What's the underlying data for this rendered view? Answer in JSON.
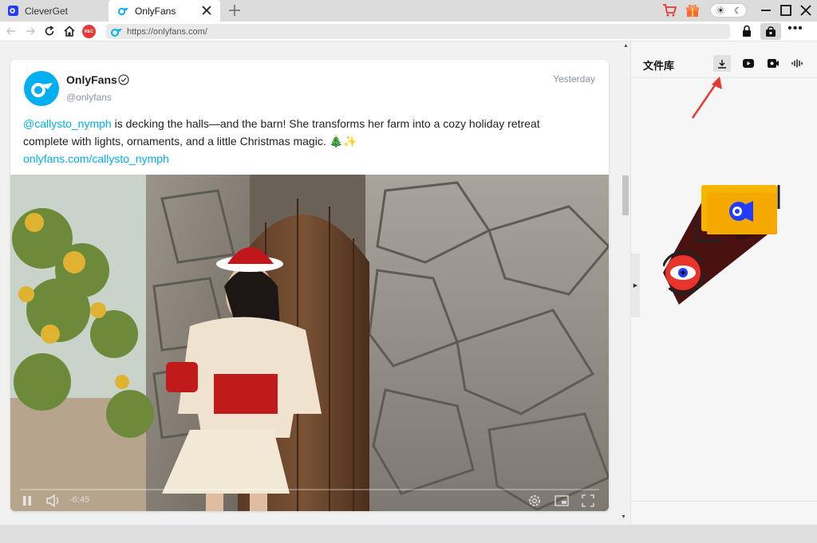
{
  "tabs": [
    {
      "label": "CleverGet",
      "active": false
    },
    {
      "label": "OnlyFans",
      "active": true
    }
  ],
  "toolbar": {
    "rec_label": "REC",
    "url": "https://onlyfans.com/"
  },
  "theme": {
    "sun": "☀",
    "moon": "☾"
  },
  "post": {
    "author": "OnlyFans",
    "handle": "@onlyfans",
    "time": "Yesterday",
    "mention": "@callysto_nymph",
    "body": " is decking the halls—and the barn! She transforms her farm into a cozy holiday retreat complete with lights, ornaments, and a little Christmas magic. 🎄✨",
    "link": "onlyfans.com/callysto_nymph"
  },
  "video": {
    "time_label": "-6:45",
    "progress": 0.0
  },
  "panel": {
    "title": "文件库",
    "tabs": [
      "download-icon",
      "youtube-icon",
      "record-icon",
      "audio-icon"
    ]
  },
  "colors": {
    "brand": "#00aff0",
    "accent_red": "#e53935",
    "illustration_yellow": "#f7b500"
  }
}
